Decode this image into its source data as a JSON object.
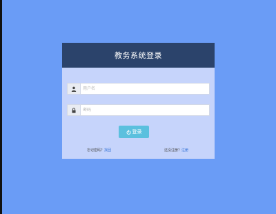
{
  "login": {
    "title": "教务系统登录",
    "username": {
      "placeholder": "用户名",
      "value": ""
    },
    "password": {
      "placeholder": "密码",
      "value": ""
    },
    "button_label": "登录",
    "forgot_prefix": "忘记密码？",
    "forgot_link": "找回",
    "register_prefix": "还没注册？",
    "register_link": "注册"
  },
  "icons": {
    "user": "user-icon",
    "lock": "lock-icon",
    "power": "power-icon"
  },
  "colors": {
    "background": "#6a9cf6",
    "panel": "#c6d4fb",
    "header": "#2b436b",
    "button": "#5bc0de",
    "link": "#2f6fd6"
  }
}
